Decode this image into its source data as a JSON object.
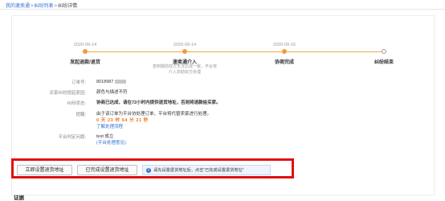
{
  "breadcrumb": {
    "home": "我的速卖通",
    "list": "纠纷列表",
    "current": "纠纷详情",
    "sep": ">"
  },
  "timeline": {
    "steps": [
      {
        "date": "2020-09-14",
        "name": "发起退款/退货",
        "desc": "",
        "status": "done"
      },
      {
        "date": "2020-09-14",
        "name": "速卖通介入",
        "desc": "若到期前双方无法达成一致，平台将介入协助双方处理",
        "status": "done"
      },
      {
        "date": "2020-09-15",
        "name": "协商完成",
        "desc": "",
        "status": "done"
      },
      {
        "date": "",
        "name": "纠纷结束",
        "desc": "",
        "status": "todo"
      }
    ]
  },
  "details": {
    "order_label": "订单号:",
    "order_value": "8018987",
    "reason_label": "买家纠纷提起原因:",
    "reason_value": "颜色与描述不符",
    "status_label": "纠纷状态:",
    "status_value": "协商已达成，请在72小时内提供退货地址，否则将退款给买家。",
    "remind_label": "提醒:",
    "remind_text": "由于该订单为平台协处理订单，平台将代替卖家进行处理。",
    "countdown": "0 天 23 时 54 分 21 秒",
    "learn_link": "了解处理流程",
    "platform_label": "平台判定问题:",
    "platform_value": "test 成立",
    "platform_link": "(平台处理意见)"
  },
  "actions": {
    "set_address": "立即设置退货地址",
    "done_address": "已完成设置退货地址",
    "tip_icon": "info-icon",
    "tip_text": "请先设置退货地址后，点击“已完成设置退货地址”"
  },
  "evidence_title": "证据",
  "colors": {
    "accent": "#f29b38",
    "status": "#19a65a",
    "countdown": "#e8741d",
    "link": "#2f6fd6",
    "highlight": "#e01010"
  }
}
